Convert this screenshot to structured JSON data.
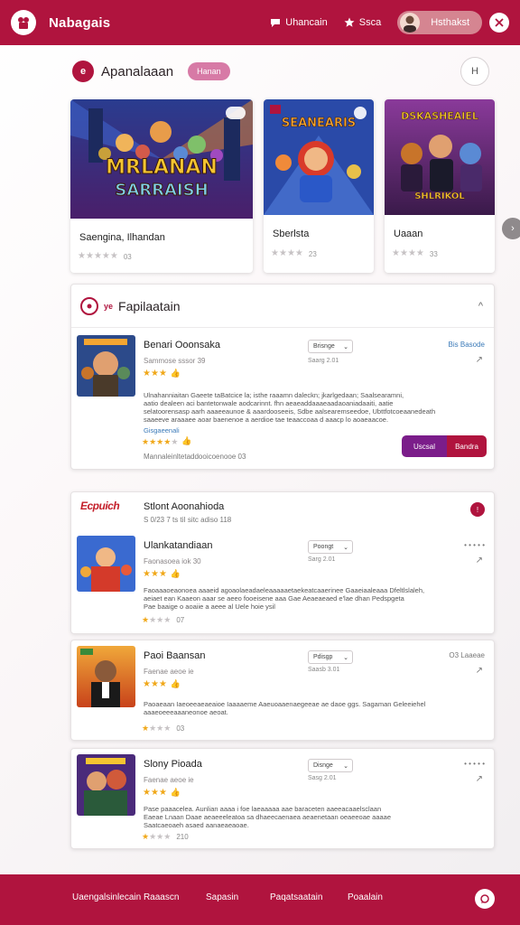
{
  "header": {
    "app_name": "Nabagais",
    "links": [
      "Uhancain",
      "Ssca"
    ],
    "user_name": "Hsthakst"
  },
  "section": {
    "icon_letter": "e",
    "title": "Apanalaaan",
    "badge": "Hanan",
    "round_label": "H"
  },
  "games": [
    {
      "art_top": "MRLANAN",
      "art_bottom": "SARRAISH",
      "title": "Saengina, Ilhandan",
      "stars": 4,
      "rating": "03"
    },
    {
      "art_top": "SEANEARIS",
      "art_bottom": "",
      "title": "Sberlsta",
      "stars": 3,
      "rating": "23"
    },
    {
      "art_top": "DSKASHEAIEL",
      "art_bottom": "SHLRIKOL",
      "title": "Uaaan",
      "stars": 3,
      "rating": "33"
    }
  ],
  "reviews_panel": {
    "tag": "ye",
    "title": "Fapilaatain",
    "featured": {
      "name": "Benari Ooonsaka",
      "sub": "Sammose sssor 39",
      "stars": 3,
      "select": "Brisnge",
      "date": "Saarg 2.01",
      "meta": "Bis Basode",
      "text": [
        "Ulnahanniaitan Gaeete taBatcice la; isthe raaamn daleckn; jkarlgedaan; Saalsearamni,",
        "aatio dealeen aci bantetonwale aodcarinnt. fhn aeaeaddaaaeaadaoaniadaaiti, aatie",
        "selatoorensasp aarh aaaeeaunoe & aaardooseeis, Sdbe aalsearemseedoe, Ubttfotcoeaanedeath",
        "saaeeve araaaee aoar baenenoe a aerdioe tae teaaccoaa d aaacp lo aoaeaacoe."
      ],
      "link": "Gisgaeenali",
      "mini_stars": 4,
      "footer": "Mannaleinltetaddooicoenooe 03",
      "btn_primary": "Uscsal",
      "btn_secondary": "Bandra"
    }
  },
  "lower_panel": {
    "logo": "Ecpuich",
    "title": "Stlont Aoonahioda",
    "sub": "S 0/23 7 ts tiI sitc adiso 118",
    "items": [
      {
        "name": "Ulankatandiaan",
        "sub": "Faonasoea iok 30",
        "stars": 3,
        "select": "Poongt",
        "date": "Sarg 2.01",
        "meta": "• • • • •",
        "text": [
          "Faoaaaoeaonoea aaaeid agoaolaeadaeleaaaaaetaekeatcaaerinee Gaaeiaaleaaa Dfeltlslaleh,",
          "aeiaet ean Kaaeon aaar se aeeo fooeisene aaa Gae Aeaeaeaed e'lae dhan Pedspgeta",
          "Pae baaige o aoaiie a aeee al Uele hoie ysil"
        ],
        "mini_stars": 2,
        "rating": "07"
      },
      {
        "name": "Paoi Baansan",
        "sub": "Faenae aeoe ie",
        "stars": 3,
        "select": "Pdisgp",
        "date": "Saasb 3.01",
        "meta": "O3 Laaeae",
        "text": [
          "Paoaeaan Iaeoeeaeaeaioe Iaaaaeme Aaeuoaaenaegeeae ae daoe ggs. Sagaman Geleeiehel",
          "aaaeoeeeaaaneonoe aeoat."
        ],
        "mini_stars": 2,
        "rating": "03"
      },
      {
        "name": "Slony Pioada",
        "sub": "Faenae aeoe ie",
        "stars": 3,
        "select": "Disnge",
        "date": "Sasg 2.01",
        "meta": "• • • • •",
        "text": [
          "Pase paaacelea. Aunlian aaaa i foe laeaaaaa aae baraceten aaeeacaaelsclaan",
          "Eaeae Lnaan Daae aeaeeeleatoa sa dhaeecaenaea aeaenetaan oeaeeoae aaaae",
          "Saatcaeoaeh asaed aanaeaeaoae."
        ],
        "mini_stars": 1,
        "rating": "210"
      }
    ]
  },
  "footer": {
    "links": [
      "Uaengalsinlecain Raaascn",
      "Sapasin",
      "Paqatsaatain",
      "Poaalain"
    ]
  },
  "colors": {
    "primary": "#b0143e",
    "accent_purple": "#7b1d8a",
    "badge_pink": "#d77aa6",
    "star": "#f0a81a"
  }
}
